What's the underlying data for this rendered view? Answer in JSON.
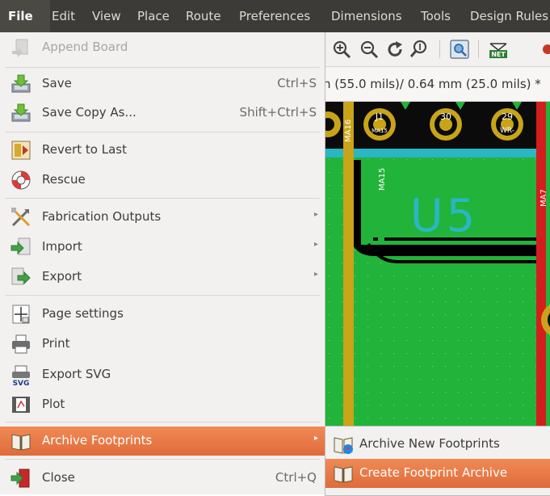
{
  "menubar": {
    "items": [
      {
        "label": "File"
      },
      {
        "label": "Edit"
      },
      {
        "label": "View"
      },
      {
        "label": "Place"
      },
      {
        "label": "Route"
      },
      {
        "label": "Preferences"
      },
      {
        "label": "Dimensions"
      },
      {
        "label": "Tools"
      },
      {
        "label": "Design Rules"
      }
    ]
  },
  "status": {
    "grid_text": "n (55.0 mils)/ 0.64 mm (25.0 mils) *"
  },
  "toolbar": {
    "icons": [
      "zoom-in-icon",
      "zoom-out-icon",
      "redraw-icon",
      "zoom-fit-icon",
      "inspect-icon",
      "netlist-icon"
    ],
    "net_label": "NET"
  },
  "pcb": {
    "pads": [
      {
        "num": "J1",
        "net": "MA15"
      },
      {
        "num": "30",
        "net": ""
      },
      {
        "num": "29",
        "net": "WR-"
      }
    ],
    "track_labels": [
      "MA16",
      "MA15",
      "MA7"
    ],
    "component_ref": "U5",
    "colors": {
      "board": "#22b33a",
      "copper": "#d8b219",
      "silk": "#2ab6c2",
      "outline": "#000000"
    }
  },
  "file_menu": {
    "items": [
      {
        "label": "Append Board",
        "shortcut": "",
        "disabled": true
      },
      {
        "label": "Save",
        "shortcut": "Ctrl+S"
      },
      {
        "label": "Save Copy As...",
        "shortcut": "Shift+Ctrl+S"
      },
      {
        "label": "Revert to Last",
        "shortcut": ""
      },
      {
        "label": "Rescue",
        "shortcut": ""
      },
      {
        "label": "Fabrication Outputs",
        "shortcut": ""
      },
      {
        "label": "Import",
        "shortcut": ""
      },
      {
        "label": "Export",
        "shortcut": ""
      },
      {
        "label": "Page settings",
        "shortcut": ""
      },
      {
        "label": "Print",
        "shortcut": ""
      },
      {
        "label": "Export SVG",
        "shortcut": ""
      },
      {
        "label": "Plot",
        "shortcut": ""
      },
      {
        "label": "Archive Footprints",
        "shortcut": ""
      },
      {
        "label": "Close",
        "shortcut": "Ctrl+Q"
      }
    ],
    "icon_texts": {
      "svg": "SVG"
    }
  },
  "submenu": {
    "items": [
      {
        "label": "Archive New Footprints"
      },
      {
        "label": "Create Footprint Archive"
      }
    ]
  },
  "accent_color": "#e8743f"
}
